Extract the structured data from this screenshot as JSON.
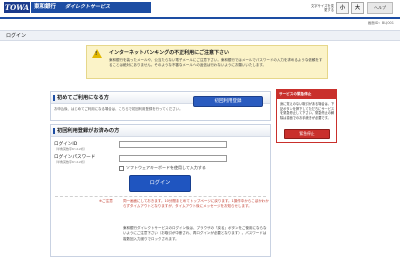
{
  "header": {
    "logo": "TOWA",
    "bank_name": "東和銀行",
    "service_name": "ダイレクトサービス",
    "fontsize_label": "文字サイズを変更する",
    "fs_small": "小",
    "fs_large": "大",
    "help_label": "ヘルプ"
  },
  "screen_id": "画面ID：BLJ001",
  "page_title": "ログイン",
  "warning": {
    "title": "インターネットバンキングの不正利用にご注意下さい",
    "text": "東和銀行を装ったメールや、公当たらない電子メールにご注意下さい。東和銀行ではメールでパスワードの入力を求めるような依頼をすることは絶対にありません。そのような不審なメールへの返信は行わないようにお願いいたします。"
  },
  "first_time": {
    "title": "初めてご利用になる方",
    "desc": "お申込後、はじめてご利用になる場合は、こちらで初回利用登録を行ってください。",
    "button": "初回利用登録"
  },
  "registered": {
    "title": "初回利用登録がお済みの方",
    "login_id_label": "ログインID",
    "login_id_hint": "（半角英数字6〜12桁）",
    "password_label": "ログインパスワード",
    "password_hint": "（半角英数字6〜12桁）",
    "software_kb_label": "ソフトウェアキーボードを使用して入力する",
    "login_button": "ログイン",
    "note_label": "※ご注意",
    "note_text": "同一画面にしておきます。10分間まとめてトップページに戻ります。1操作中からこぼかわからずタイムアウトとなりますが、タイムアウト後にメッセージをお知らせします。",
    "note_text2": "東和銀行ダイレクトサービスのログイン後は、ブラウザの「戻る」ボタンをご使用にならないようにご注意下さい（お取引が中断され、再ログインが必要となります）。パスワードは複数回入力誤りでロックされます。"
  },
  "emergency": {
    "title": "サービスの緊急停止",
    "text": "身に覚えのない取引がある場合は、下記ボタンを押下してただちにサービスを緊急停止して下さい。緊急停止の解除は書面でのお手続きが必要です。",
    "button": "緊急停止"
  }
}
